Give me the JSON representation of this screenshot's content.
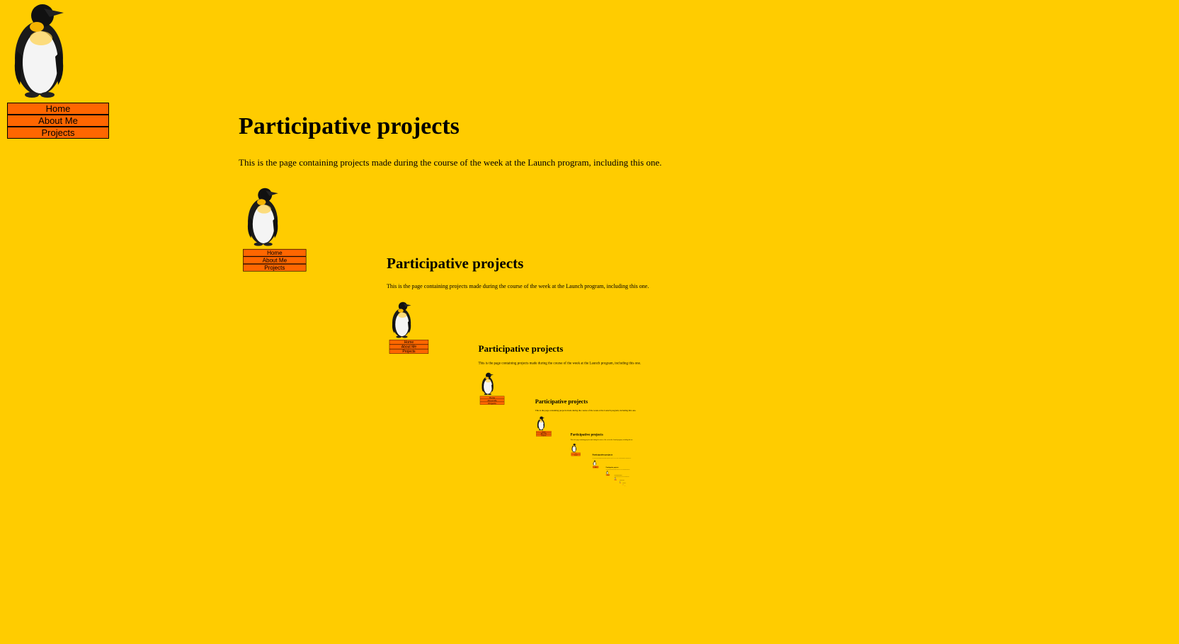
{
  "page": {
    "title": "Participative projects",
    "intro": "This is the page containing projects made during the course of the week at the Launch program, including this one."
  },
  "nav": {
    "items": [
      {
        "label": "Home"
      },
      {
        "label": "About Me"
      },
      {
        "label": "Projects"
      }
    ]
  },
  "logo": {
    "icon": "penguin-icon"
  },
  "colors": {
    "background": "#ffcc00",
    "nav_background": "#ff6600",
    "nav_border": "#000000",
    "text": "#000000"
  }
}
